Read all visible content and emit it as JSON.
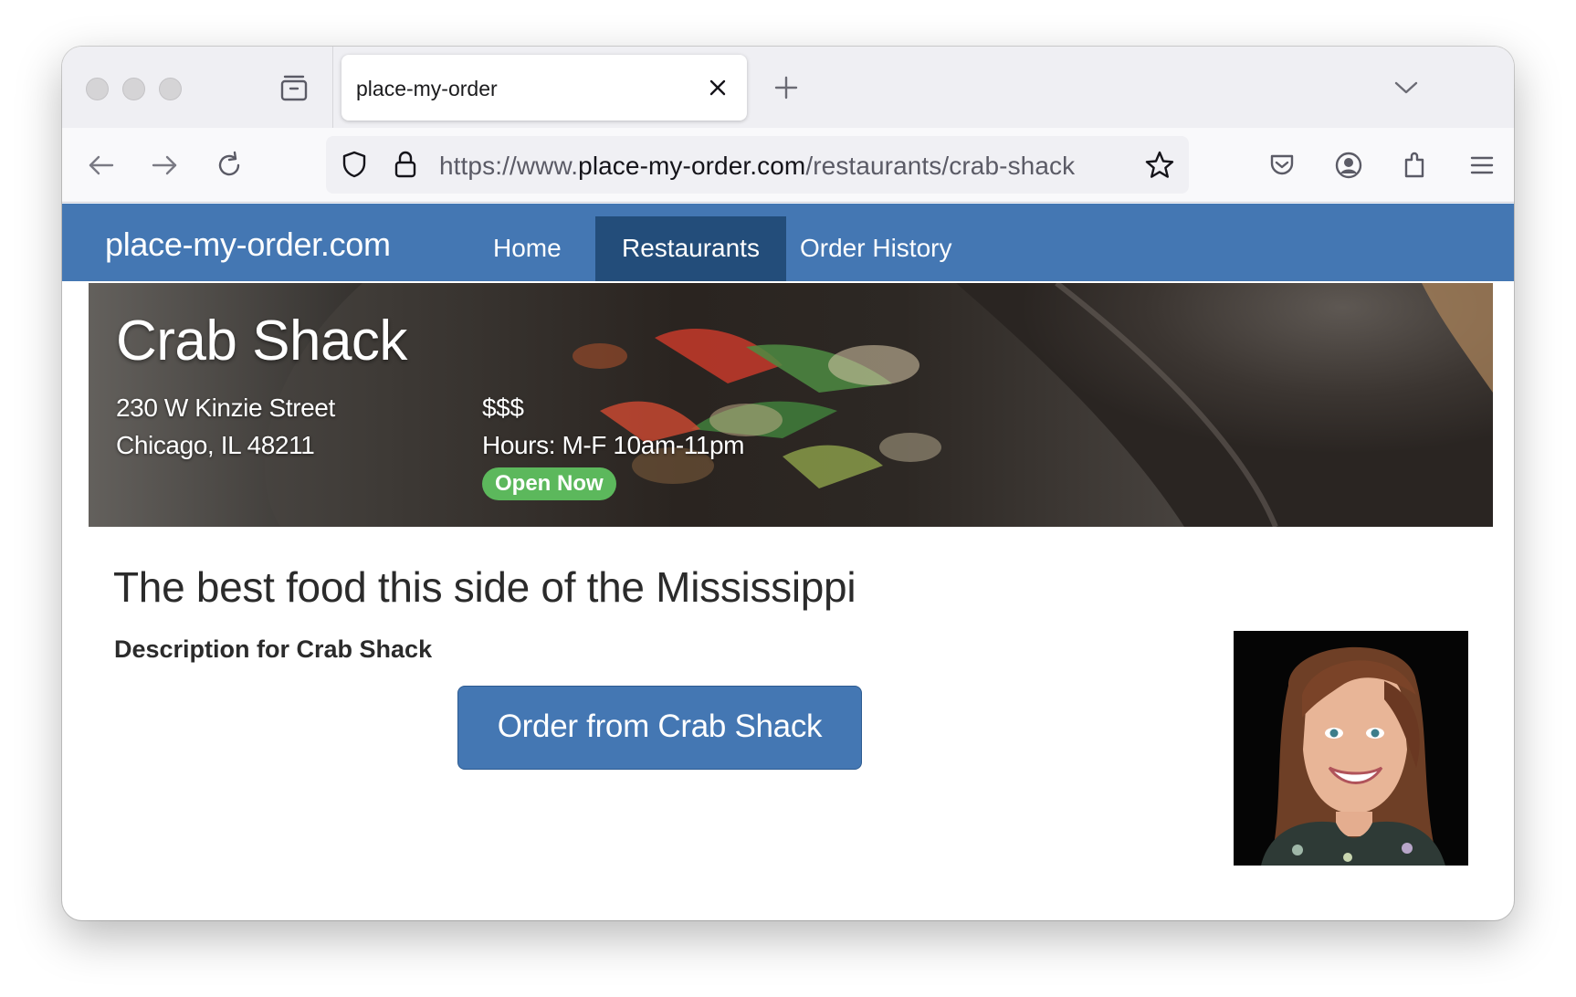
{
  "browser": {
    "tab_title": "place-my-order",
    "url_prefix": "https://www.",
    "url_domain": "place-my-order.com",
    "url_path": "/restaurants/crab-shack",
    "icons": [
      "back-icon",
      "forward-icon",
      "reload-icon",
      "shield-icon",
      "lock-icon",
      "bookmark-star-icon",
      "pocket-icon",
      "account-icon",
      "extensions-icon",
      "menu-icon",
      "tab-overview-icon",
      "close-icon",
      "plus-icon",
      "chevron-down-icon"
    ]
  },
  "site": {
    "brand": "place-my-order.com",
    "nav": [
      {
        "label": "Home",
        "active": false
      },
      {
        "label": "Restaurants",
        "active": true
      },
      {
        "label": "Order History",
        "active": false
      }
    ],
    "colors": {
      "nav": "#4477b3",
      "nav_active": "#234d7a",
      "badge": "#5cb85c"
    }
  },
  "restaurant": {
    "name": "Crab Shack",
    "address_line1": "230 W Kinzie Street",
    "address_line2": "Chicago, IL 48211",
    "price": "$$$",
    "hours": "Hours: M-F 10am-11pm",
    "status": "Open Now",
    "tagline": "The best food this side of the Mississippi",
    "description": "Description for Crab Shack",
    "order_button": "Order from Crab Shack"
  }
}
